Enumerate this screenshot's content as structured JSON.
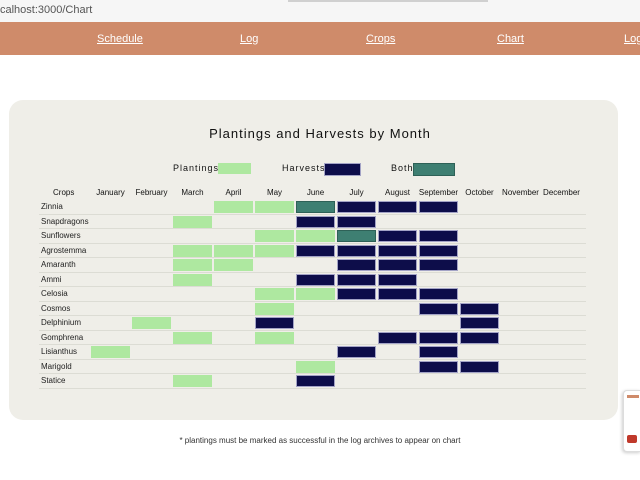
{
  "browser": {
    "url": "calhost:3000/Chart"
  },
  "nav": {
    "links": [
      "Schedule",
      "Log",
      "Crops",
      "Chart",
      "Log"
    ]
  },
  "chart_title": "Plantings and Harvests by Month",
  "legend": [
    {
      "label": "Plantings",
      "kind": "planting"
    },
    {
      "label": "Harvests",
      "kind": "harvest"
    },
    {
      "label": "Both",
      "kind": "both"
    }
  ],
  "colors": {
    "planting": "#aee8a0",
    "harvest": "#0d0d4a",
    "both": "#3e7f72",
    "nav": "#cf8b6a",
    "card": "#efeee8"
  },
  "footnote": "* plantings must be marked as successful in the log archives to appear on chart",
  "chart_data": {
    "type": "table",
    "row_header": "Crops",
    "months": [
      "January",
      "February",
      "March",
      "April",
      "May",
      "June",
      "July",
      "August",
      "September",
      "October",
      "November",
      "December"
    ],
    "rows": [
      {
        "crop": "Zinnia",
        "cells": [
          "",
          "",
          "",
          "P",
          "P",
          "B",
          "H",
          "H",
          "H",
          "",
          "",
          ""
        ]
      },
      {
        "crop": "Snapdragons",
        "cells": [
          "",
          "",
          "P",
          "",
          "",
          "H",
          "H",
          "",
          "",
          "",
          "",
          ""
        ]
      },
      {
        "crop": "Sunflowers",
        "cells": [
          "",
          "",
          "",
          "",
          "P",
          "P",
          "B",
          "H",
          "H",
          "",
          "",
          ""
        ]
      },
      {
        "crop": "Agrostemma",
        "cells": [
          "",
          "",
          "P",
          "P",
          "P",
          "H",
          "H",
          "H",
          "H",
          "",
          "",
          ""
        ]
      },
      {
        "crop": "Amaranth",
        "cells": [
          "",
          "",
          "P",
          "P",
          "",
          "",
          "H",
          "H",
          "H",
          "",
          "",
          ""
        ]
      },
      {
        "crop": "Ammi",
        "cells": [
          "",
          "",
          "P",
          "",
          "",
          "H",
          "H",
          "H",
          "",
          "",
          "",
          ""
        ]
      },
      {
        "crop": "Celosia",
        "cells": [
          "",
          "",
          "",
          "",
          "P",
          "P",
          "H",
          "H",
          "H",
          "",
          "",
          ""
        ]
      },
      {
        "crop": "Cosmos",
        "cells": [
          "",
          "",
          "",
          "",
          "P",
          "",
          "",
          "",
          "H",
          "H",
          "",
          ""
        ]
      },
      {
        "crop": "Delphinium",
        "cells": [
          "",
          "P",
          "",
          "",
          "H",
          "",
          "",
          "",
          "",
          "H",
          "",
          ""
        ]
      },
      {
        "crop": "Gomphrena",
        "cells": [
          "",
          "",
          "P",
          "",
          "P",
          "",
          "",
          "H",
          "H",
          "H",
          "",
          ""
        ]
      },
      {
        "crop": "Lisianthus",
        "cells": [
          "P",
          "",
          "",
          "",
          "",
          "",
          "H",
          "",
          "H",
          "",
          "",
          ""
        ]
      },
      {
        "crop": "Marigold",
        "cells": [
          "",
          "",
          "",
          "",
          "",
          "P",
          "",
          "",
          "H",
          "H",
          "",
          ""
        ]
      },
      {
        "crop": "Statice",
        "cells": [
          "",
          "",
          "P",
          "",
          "",
          "H",
          "",
          "",
          "",
          "",
          "",
          ""
        ]
      }
    ]
  }
}
